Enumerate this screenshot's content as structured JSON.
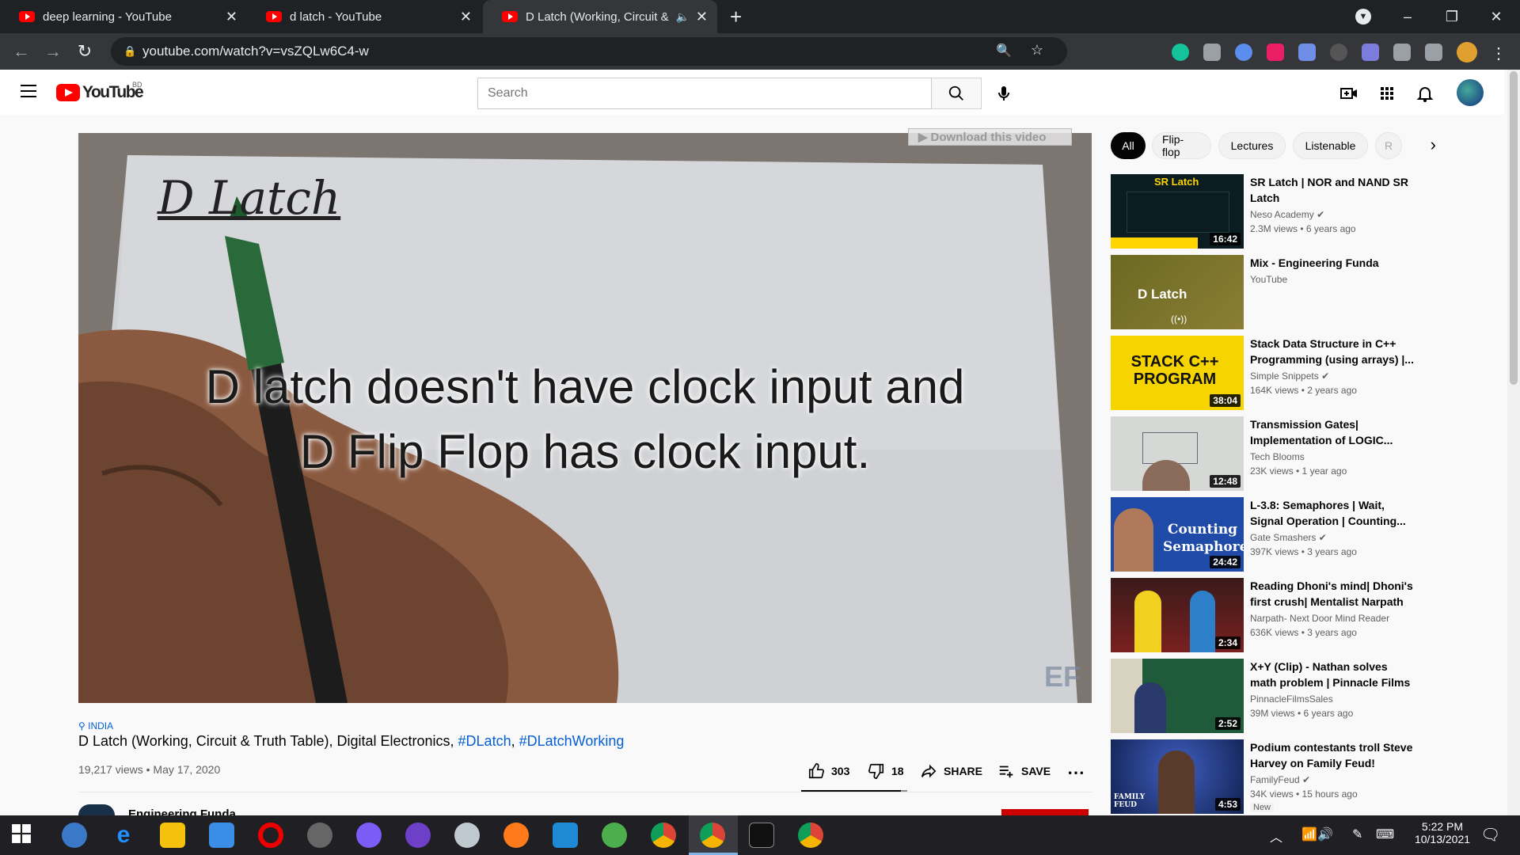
{
  "browser": {
    "tabs": [
      {
        "title": "deep learning - YouTube"
      },
      {
        "title": "d latch - YouTube"
      },
      {
        "title": "D Latch (Working, Circuit & T",
        "audio_icon": "speaker-icon"
      }
    ],
    "new_tab": "+",
    "window_controls": [
      "–",
      "❐",
      "✕"
    ],
    "url": "youtube.com/watch?v=vsZQLw6C4-w"
  },
  "youtube": {
    "logo_text": "YouTube",
    "country_code": "BD",
    "search_placeholder": "Search",
    "video": {
      "overlay_line1": "D latch doesn't have clock input and",
      "overlay_line2": "D Flip Flop has clock input.",
      "paper_title": "D Latch",
      "watermark": "EF",
      "download_label": "Download this video",
      "location": "INDIA",
      "title": "D Latch (Working, Circuit & Truth Table), Digital Electronics,",
      "hashtag1": "#DLatch",
      "hashtag2": "#DLatchWorking",
      "views": "19,217 views",
      "date": "May 17, 2020",
      "likes": "303",
      "dislikes": "18",
      "share_label": "SHARE",
      "save_label": "SAVE",
      "channel_name": "Engineering Funda"
    },
    "chips": [
      "All",
      "Flip-flop",
      "Lectures",
      "Listenable",
      "R"
    ],
    "recommendations": [
      {
        "title": "SR Latch | NOR and NAND SR Latch",
        "channel": "Neso Academy",
        "meta": "2.3M views • 6 years ago",
        "duration": "16:42",
        "thumb_text": "SR Latch"
      },
      {
        "title": "Mix - Engineering Funda",
        "channel": "YouTube",
        "meta": "",
        "duration": "",
        "thumb_text": "D Latch"
      },
      {
        "title": "Stack Data Structure in C++ Programming (using arrays) |...",
        "channel": "Simple Snippets",
        "meta": "164K views • 2 years ago",
        "duration": "38:04",
        "thumb_text": "STACK C++ PROGRAM"
      },
      {
        "title": "Transmission Gates| Implementation of LOGIC...",
        "channel": "Tech Blooms",
        "meta": "23K views • 1 year ago",
        "duration": "12:48",
        "thumb_text": ""
      },
      {
        "title": "L-3.8: Semaphores | Wait, Signal Operation | Counting...",
        "channel": "Gate Smashers",
        "meta": "397K views • 3 years ago",
        "duration": "24:42",
        "thumb_text": "Counting Semaphore"
      },
      {
        "title": "Reading Dhoni's mind| Dhoni's first crush| Mentalist Narpath",
        "channel": "Narpath- Next Door Mind Reader",
        "meta": "636K views • 3 years ago",
        "duration": "2:34",
        "thumb_text": ""
      },
      {
        "title": "X+Y (Clip) - Nathan solves math problem | Pinnacle Films",
        "channel": "PinnacleFilmsSales",
        "meta": "39M views • 6 years ago",
        "duration": "2:52",
        "thumb_text": ""
      },
      {
        "title": "Podium contestants troll Steve Harvey on Family Feud!",
        "channel": "FamilyFeud",
        "meta": "34K views • 15 hours ago",
        "duration": "4:53",
        "badge": "New",
        "thumb_text": "FAMILY FEUD"
      }
    ]
  },
  "taskbar": {
    "time": "5:22 PM",
    "date": "10/13/2021"
  },
  "colors": {
    "yt_red": "#ff0000",
    "link_blue": "#065fd4",
    "tab_bg": "#202124"
  }
}
